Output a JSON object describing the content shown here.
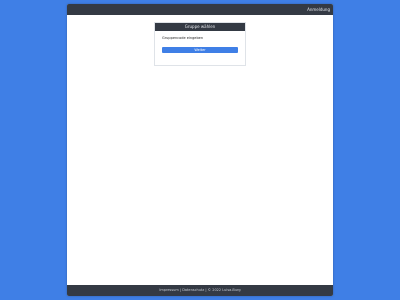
{
  "topbar": {
    "login_label": "Anmeldung"
  },
  "card": {
    "title": "Gruppe wählen",
    "message": "Gruppencode eingeben",
    "button_label": "Weiter"
  },
  "footer": {
    "imprint": "Impressum",
    "separator": " | ",
    "privacy": "Datenschutz",
    "copyright": " | © 2022 Luisa-Burg"
  },
  "colors": {
    "background": "#3f7fe6",
    "bar": "#343a44",
    "accent": "#3f7fe6"
  }
}
